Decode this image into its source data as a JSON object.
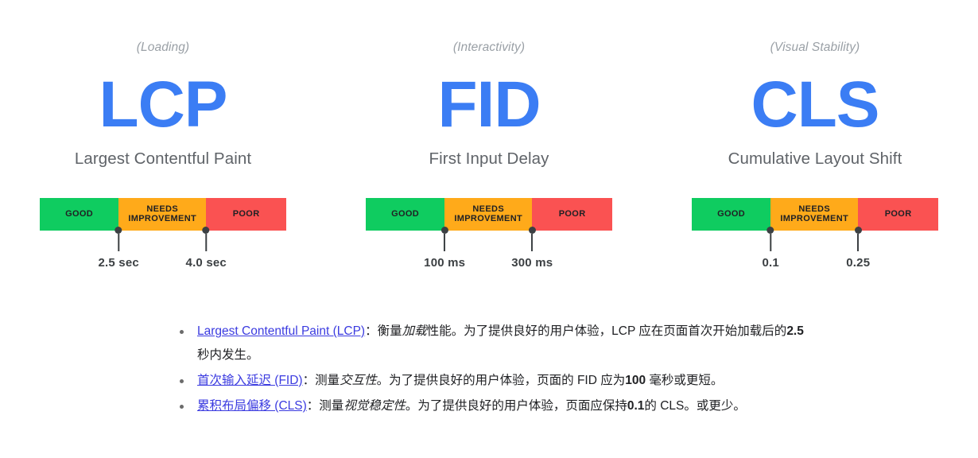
{
  "metrics": [
    {
      "category": "(Loading)",
      "acronym": "LCP",
      "title": "Largest Contentful Paint",
      "segments": [
        {
          "label": "GOOD",
          "color": "#0fcc60",
          "width_pct": 32
        },
        {
          "label": "NEEDS IMPROVEMENT",
          "color": "#ffaa1a",
          "width_pct": 35.5
        },
        {
          "label": "POOR",
          "color": "#fa5252",
          "width_pct": 32.5
        }
      ],
      "thresholds": [
        {
          "value": "2.5 sec",
          "position_pct": 32
        },
        {
          "value": "4.0 sec",
          "position_pct": 67.5
        }
      ]
    },
    {
      "category": "(Interactivity)",
      "acronym": "FID",
      "title": "First Input Delay",
      "segments": [
        {
          "label": "GOOD",
          "color": "#0fcc60",
          "width_pct": 32
        },
        {
          "label": "NEEDS IMPROVEMENT",
          "color": "#ffaa1a",
          "width_pct": 35.5
        },
        {
          "label": "POOR",
          "color": "#fa5252",
          "width_pct": 32.5
        }
      ],
      "thresholds": [
        {
          "value": "100 ms",
          "position_pct": 32
        },
        {
          "value": "300 ms",
          "position_pct": 67.5
        }
      ]
    },
    {
      "category": "(Visual Stability)",
      "acronym": "CLS",
      "title": "Cumulative Layout Shift",
      "segments": [
        {
          "label": "GOOD",
          "color": "#0fcc60",
          "width_pct": 32
        },
        {
          "label": "NEEDS IMPROVEMENT",
          "color": "#ffaa1a",
          "width_pct": 35.5
        },
        {
          "label": "POOR",
          "color": "#fa5252",
          "width_pct": 32.5
        }
      ],
      "thresholds": [
        {
          "value": "0.1",
          "position_pct": 32
        },
        {
          "value": "0.25",
          "position_pct": 67.5
        }
      ]
    }
  ],
  "notes": [
    {
      "link": "Largest Contentful Paint (LCP)",
      "after_link": "：衡量",
      "emphasis": "加载",
      "tail_before_strong": "性能。为了提供良好的用户体验，LCP 应在页面首次开始加载后的",
      "strong": "2.5",
      "tail_after_strong": " 秒内发生。"
    },
    {
      "link": "首次输入延迟 (FID)",
      "after_link": "：测量",
      "emphasis": "交互性",
      "tail_before_strong": "。为了提供良好的用户体验，页面的 FID 应为",
      "strong": "100",
      "tail_after_strong": " 毫秒或更短。"
    },
    {
      "link": "累积布局偏移 (CLS)",
      "after_link": "：测量",
      "emphasis": "视觉稳定性",
      "tail_before_strong": "。为了提供良好的用户体验，页面应保持",
      "strong": "0.1",
      "tail_after_strong": "的 CLS。或更少。"
    }
  ],
  "colors": {
    "good": "#0fcc60",
    "needs_improvement": "#ffaa1a",
    "poor": "#fa5252",
    "accent_blue": "#3b7df4",
    "link_blue": "#3b3be0",
    "marker": "#3c4043",
    "muted_text": "#9aa0a6",
    "title_text": "#5f6368"
  }
}
